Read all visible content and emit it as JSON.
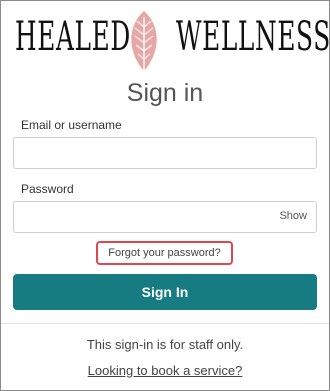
{
  "brand": {
    "left_text": "HEALED",
    "right_text": "WELLNESS",
    "leaf_color": "#e6a7a5"
  },
  "title": "Sign in",
  "email": {
    "label": "Email or username",
    "value": "",
    "placeholder": ""
  },
  "password": {
    "label": "Password",
    "value": "",
    "placeholder": "",
    "toggle_label": "Show"
  },
  "forgot_link": "Forgot your password?",
  "signin_button": "Sign In",
  "staff_notice": "This sign-in is for staff only.",
  "book_link": "Looking to book a service?",
  "colors": {
    "accent": "#177b82",
    "highlight_border": "#e0474c"
  }
}
